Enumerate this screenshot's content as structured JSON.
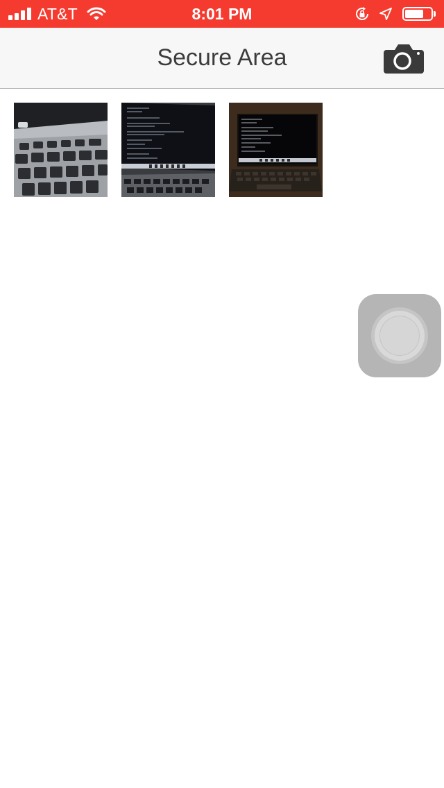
{
  "status_bar": {
    "carrier": "AT&T",
    "time": "8:01 PM",
    "background": "#f53b30",
    "icons": [
      "signal-icon",
      "wifi-icon",
      "rotation-lock-icon",
      "location-icon",
      "battery-icon"
    ]
  },
  "nav_bar": {
    "title": "Secure Area",
    "action_icon": "camera-icon"
  },
  "photos": [
    {
      "subject": "laptop-keyboard"
    },
    {
      "subject": "laptop-terminal-screen"
    },
    {
      "subject": "laptop-dark-terminal"
    }
  ],
  "assistive_touch": {
    "icon": "assistive-touch-icon"
  }
}
